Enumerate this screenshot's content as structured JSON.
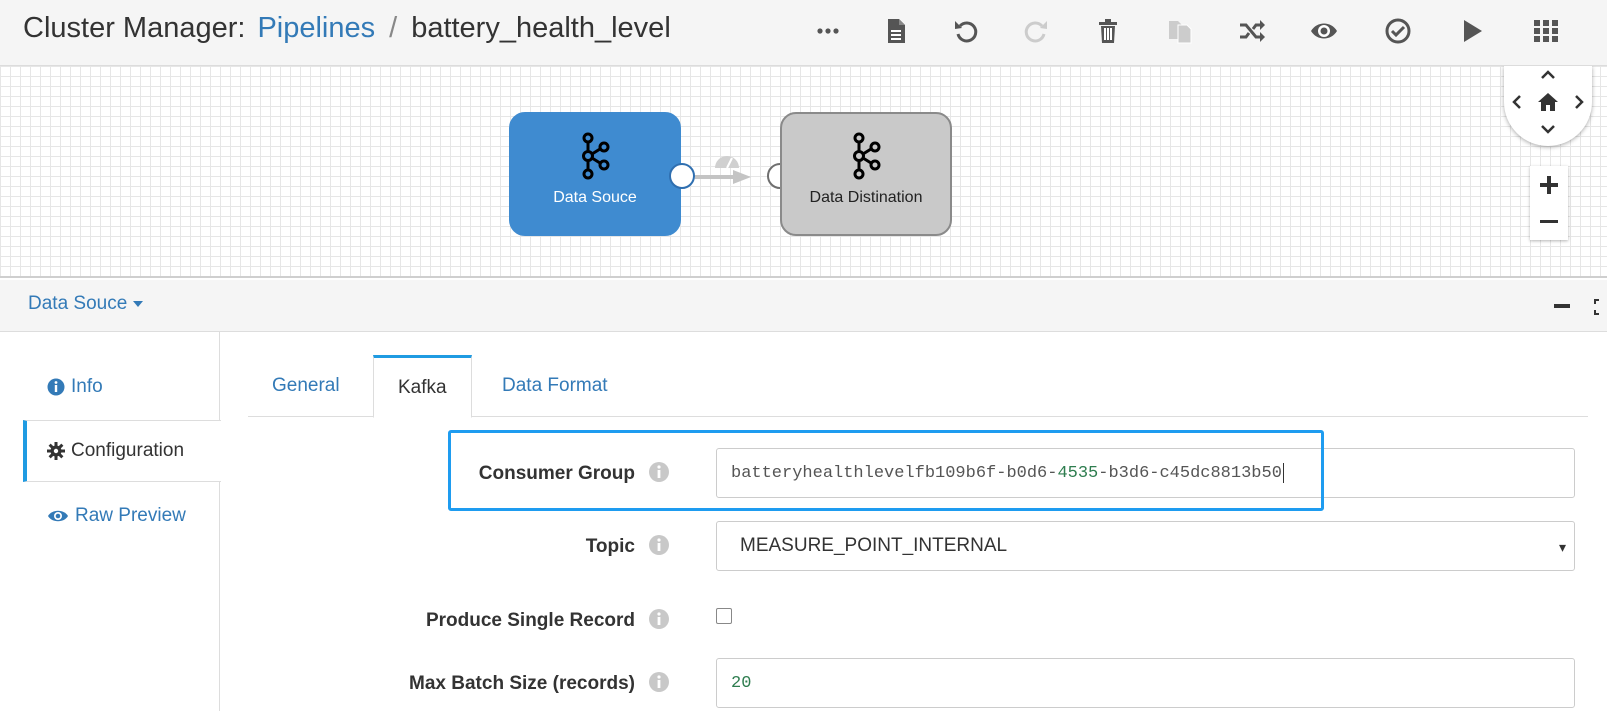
{
  "header": {
    "app_label": "Cluster Manager:",
    "breadcrumb_link": "Pipelines",
    "separator": "/",
    "pipeline_name": "battery_health_level"
  },
  "toolbar_icons": [
    "more-icon",
    "document-icon",
    "undo-icon",
    "redo-icon",
    "delete-icon",
    "copy-icon",
    "shuffle-icon",
    "preview-eye-icon",
    "validate-check-icon",
    "run-play-icon",
    "apps-grid-icon"
  ],
  "canvas": {
    "source_stage": {
      "label": "Data Souce",
      "icon": "kafka-icon",
      "color": "#3f8bd0"
    },
    "destination_stage": {
      "label": "Data Distination",
      "icon": "kafka-icon",
      "color": "#c9c9c9"
    }
  },
  "panel": {
    "stage_selector": "Data Souce",
    "side_nav": [
      {
        "label": "Info",
        "icon": "info-icon",
        "active": false
      },
      {
        "label": "Configuration",
        "icon": "gear-icon",
        "active": true
      },
      {
        "label": "Raw Preview",
        "icon": "eye-icon",
        "active": false
      }
    ],
    "tabs": [
      {
        "label": "General",
        "active": false
      },
      {
        "label": "Kafka",
        "active": true
      },
      {
        "label": "Data Format",
        "active": false
      }
    ]
  },
  "form": {
    "consumer_group": {
      "label": "Consumer Group",
      "value_a": "batteryhealthlevelfb109b6f-b0d6-",
      "value_num": "4535",
      "value_b": "-b3d6-c45dc8813b50"
    },
    "topic": {
      "label": "Topic",
      "value": "MEASURE_POINT_INTERNAL"
    },
    "produce_single_record": {
      "label": "Produce Single Record",
      "checked": false
    },
    "max_batch_size": {
      "label": "Max Batch Size (records)",
      "value": "20"
    }
  },
  "colors": {
    "accent": "#337ab7",
    "active_tab_border": "#1f9be2",
    "highlight": "#1e9cf0"
  }
}
